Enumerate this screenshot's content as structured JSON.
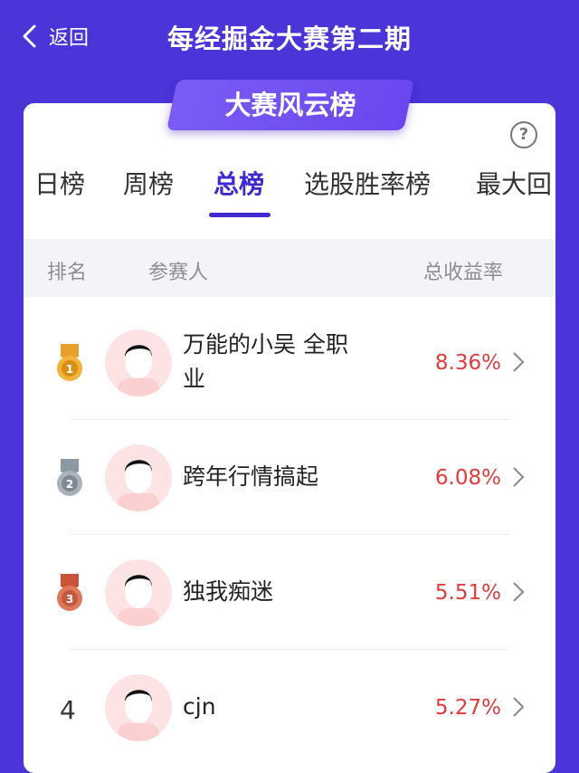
{
  "header": {
    "back_label": "返回",
    "title": "每经掘金大赛第二期"
  },
  "banner": {
    "title": "大赛风云榜"
  },
  "help_label": "?",
  "tabs": [
    "日榜",
    "周榜",
    "总榜",
    "选股胜率榜",
    "最大回"
  ],
  "active_tab": "总榜",
  "table": {
    "col_rank": "排名",
    "col_user": "参赛人",
    "col_rate": "总收益率",
    "rows": [
      {
        "rank": "1",
        "medal": "gold-medal-icon",
        "name": "万能的小吴 全职业",
        "rate": "8.36%"
      },
      {
        "rank": "2",
        "medal": "silver-medal-icon",
        "name": "跨年行情搞起",
        "rate": "6.08%"
      },
      {
        "rank": "3",
        "medal": "bronze-medal-icon",
        "name": "独我痴迷",
        "rate": "5.51%"
      },
      {
        "rank": "4",
        "medal": "",
        "name": "cjn",
        "rate": "5.27%"
      }
    ]
  },
  "colors": {
    "background": "#4b34d8",
    "accent": "#3d2ad0",
    "rate": "#e23b3b",
    "gold": "#f0a428",
    "silver": "#9aa3ad",
    "bronze": "#d9694a"
  }
}
